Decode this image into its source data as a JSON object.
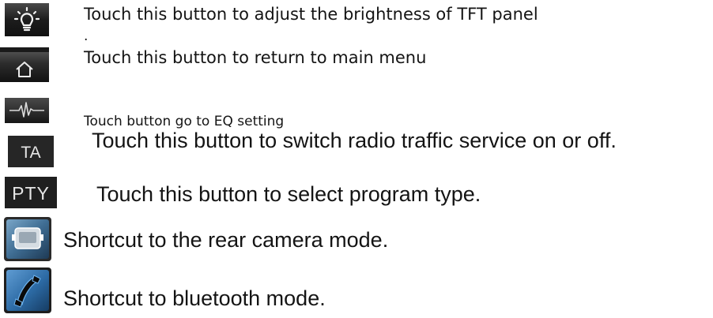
{
  "rows": [
    {
      "icon": "brightness-bulb-icon",
      "text": "Touch this button to adjust the brightness of TFT panel",
      "extra": "."
    },
    {
      "icon": "home-icon",
      "text": "Touch this button to return to main menu"
    },
    {
      "icon": "eq-waveform-icon",
      "text": "Touch button go to EQ setting"
    },
    {
      "icon": "ta-icon",
      "icon_label": "TA",
      "text": "Touch this button to switch radio traffic service on or off."
    },
    {
      "icon": "pty-icon",
      "icon_label": "PTY",
      "text": "Touch this button to select program type."
    },
    {
      "icon": "rear-camera-icon",
      "text": "Shortcut  to the rear camera mode."
    },
    {
      "icon": "bluetooth-phone-icon",
      "text": "Shortcut  to bluetooth mode."
    }
  ]
}
